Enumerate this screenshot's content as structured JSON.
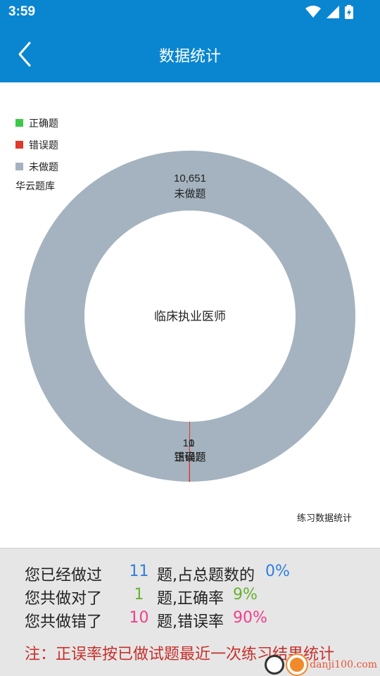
{
  "status": {
    "time": "3:59"
  },
  "header": {
    "title": "数据统计"
  },
  "legend": [
    {
      "label": "正确题",
      "color": "#3ec94a"
    },
    {
      "label": "错误题",
      "color": "#e03a2c"
    },
    {
      "label": "未做题",
      "color": "#a4b3bf"
    }
  ],
  "bank_label": "华云题库",
  "chart_data": {
    "type": "pie",
    "center_label": "临床执业医师",
    "slices": [
      {
        "label": "正确题",
        "value": 1,
        "color": "#3ec94a"
      },
      {
        "label": "错误题",
        "value": 10,
        "color": "#e03a2c"
      },
      {
        "label": "未做题",
        "value": 10651,
        "color": "#a4b3bf"
      }
    ],
    "data_labels": {
      "unanswered": {
        "value": "10,651",
        "name": "未做题"
      },
      "wrong": {
        "value": "10",
        "name": "错误题"
      },
      "correct": {
        "value": "1",
        "name": "正确题"
      }
    },
    "caption": "练习数据统计"
  },
  "stats": {
    "row1": {
      "prefix": "您已经做过",
      "value": "11",
      "mid": "题,占总题数的",
      "rate": "0%"
    },
    "row2": {
      "prefix": "您共做对了",
      "value": "1",
      "mid": "题,正确率",
      "rate": "9%"
    },
    "row3": {
      "prefix": "您共做错了",
      "value": "10",
      "mid": "题,错误率",
      "rate": "90%"
    },
    "note": "注：正误率按已做试题最近一次练习结果统计"
  },
  "colors": {
    "primary": "#0a86d0",
    "blue_value": "#2f7fe0",
    "green_value": "#66b030",
    "pink_value": "#ef3f8c",
    "note": "#c6302b"
  },
  "watermark": {
    "text": "danji100.com"
  }
}
